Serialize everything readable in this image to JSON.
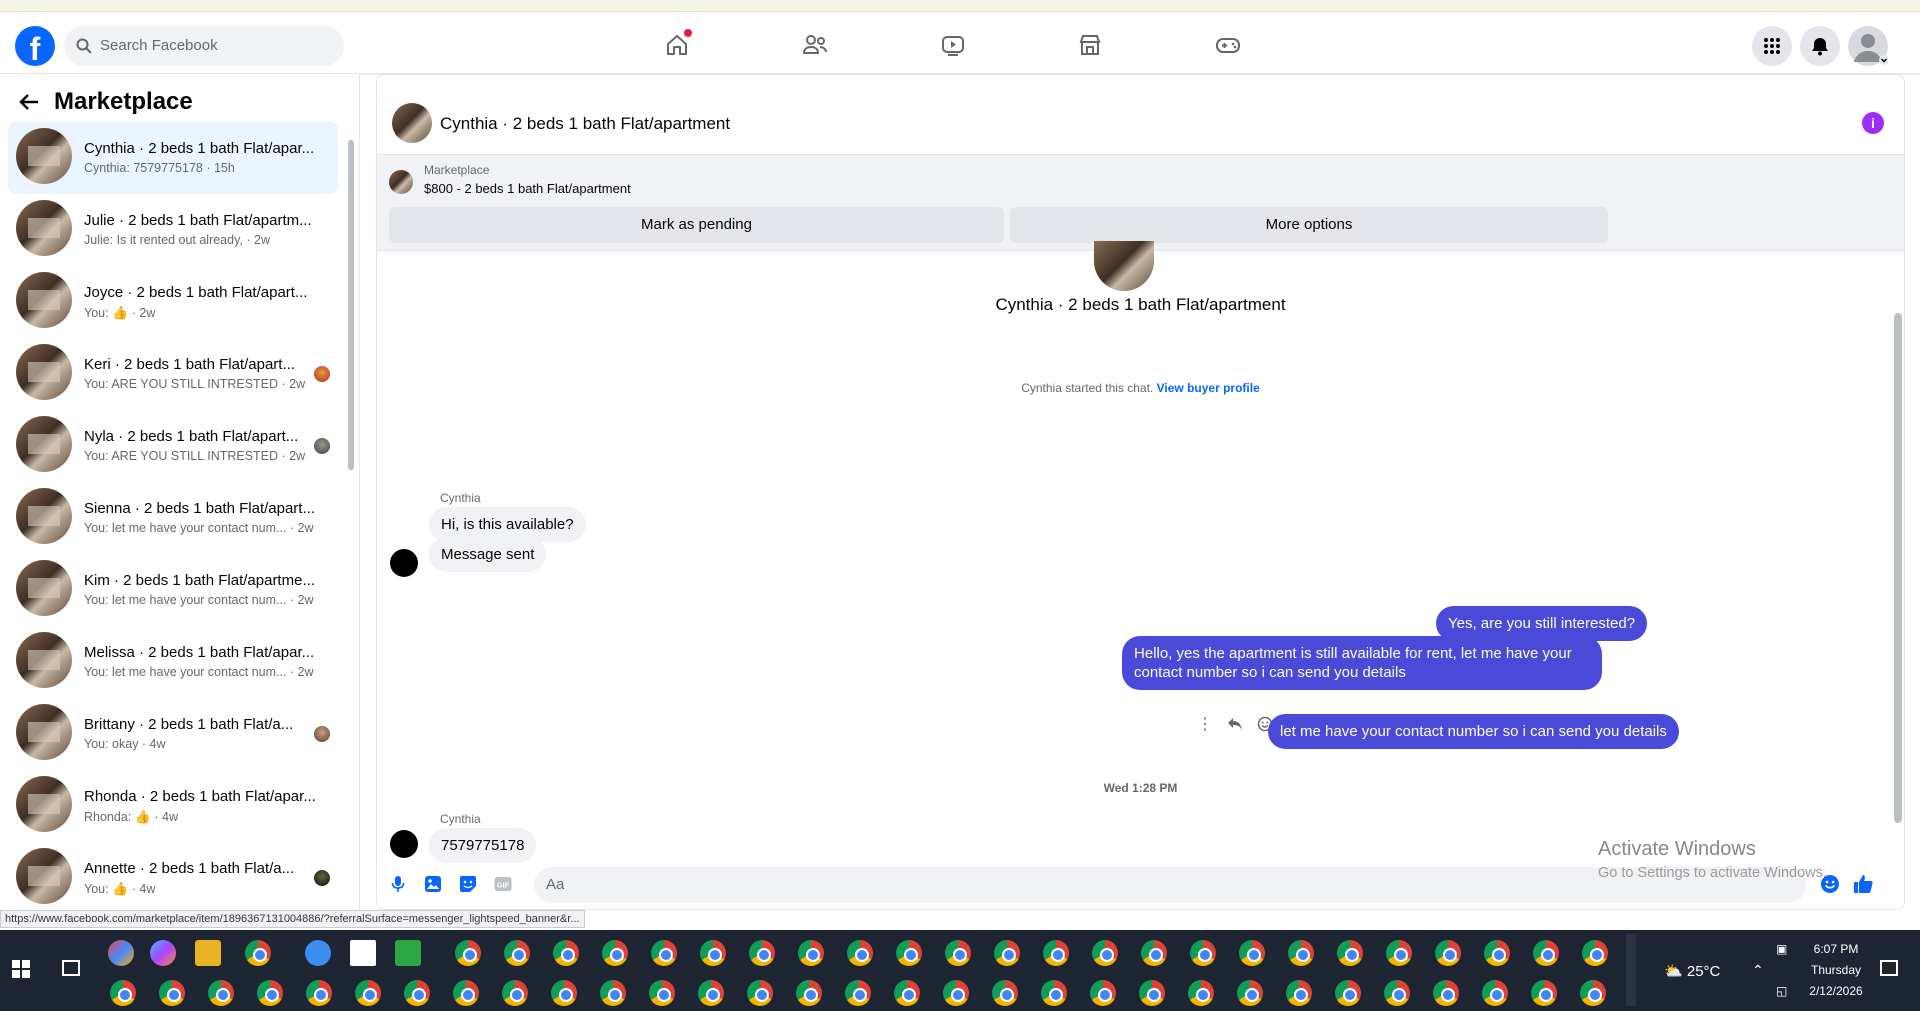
{
  "topbar": {
    "search_placeholder": "Search Facebook"
  },
  "sidebar": {
    "title": "Marketplace",
    "conversations": [
      {
        "title": "Cynthia · 2 beds 1 bath Flat/apar...",
        "subtitle": "Cynthia: 7579775178 · 15h",
        "active": true
      },
      {
        "title": "Julie · 2 beds 1 bath Flat/apartm...",
        "subtitle": "Julie: Is it rented out already, · 2w"
      },
      {
        "title": "Joyce · 2 beds 1 bath Flat/apart...",
        "subtitle_prefix": "You:",
        "subtitle_suffix": "· 2w"
      },
      {
        "title": "Keri · 2 beds 1 bath Flat/apart...",
        "subtitle": "You: ARE YOU STILL INTRESTED · 2w"
      },
      {
        "title": "Nyla · 2 beds 1 bath Flat/apart...",
        "subtitle": "You: ARE YOU STILL INTRESTED · 2w"
      },
      {
        "title": "Sienna · 2 beds 1 bath Flat/apart...",
        "subtitle": "You: let me have your contact num... · 2w"
      },
      {
        "title": "Kim · 2 beds 1 bath Flat/apartme...",
        "subtitle": "You: let me have your contact num... · 2w"
      },
      {
        "title": "Melissa · 2 beds 1 bath Flat/apar...",
        "subtitle": "You: let me have your contact num... · 2w"
      },
      {
        "title": "Brittany · 2 beds 1 bath Flat/a...",
        "subtitle": "You: okay · 4w"
      },
      {
        "title": "Rhonda · 2 beds 1 bath Flat/apar...",
        "subtitle_prefix": "Rhonda:",
        "subtitle_suffix": "· 4w"
      },
      {
        "title": "Annette · 2 beds 1 bath Flat/a...",
        "subtitle_prefix": "You:",
        "subtitle_suffix": "· 4w"
      }
    ]
  },
  "chat": {
    "header_name": "Cynthia · 2 beds 1 bath Flat/apartment",
    "marketplace_label": "Marketplace",
    "listing": "$800 - 2 beds 1 bath Flat/apartment",
    "btn_pending": "Mark as pending",
    "btn_more": "More options",
    "center_name": "Cynthia · 2 beds 1 bath Flat/apartment",
    "started_text": "Cynthia started this chat.",
    "view_profile": "View buyer profile",
    "sender1": "Cynthia",
    "msg1": "Hi, is this available?",
    "msg2": "Message sent",
    "me1": "Yes, are you still interested?",
    "me2": "Hello, yes the apartment is still available for rent, let me have your contact number so i can send you details",
    "me3": "let me have your contact number so i can send you details",
    "timestamp": "Wed 1:28 PM",
    "sender2": "Cynthia",
    "msg3": "7579775178",
    "composer_placeholder": "Aa"
  },
  "watermark": {
    "line1": "Activate Windows",
    "line2": "Go to Settings to activate Windows."
  },
  "status_url": "https://www.facebook.com/marketplace/item/1896367131004886/?referralSurface=messenger_lightspeed_banner&r...",
  "taskbar": {
    "temperature": "25°C",
    "time": "6:07 PM",
    "day": "Thursday",
    "date": "2/12/2026"
  }
}
